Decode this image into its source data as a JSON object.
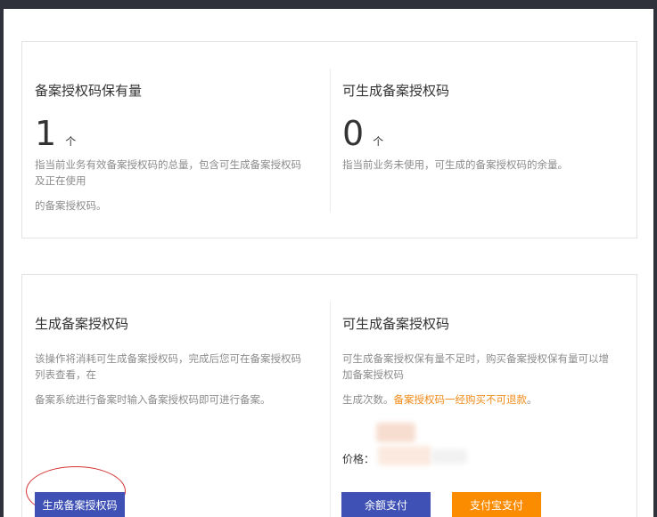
{
  "holdings_card": {
    "left": {
      "title": "备案授权码保有量",
      "count": "1",
      "unit": "个",
      "desc_line1": "指当前业务有效备案授权码的总量，包含可生成备案授权码及正在使用",
      "desc_line2": "的备案授权码。"
    },
    "right": {
      "title": "可生成备案授权码",
      "count": "0",
      "unit": "个",
      "desc": "指当前业务未使用，可生成的备案授权码的余量。"
    }
  },
  "generate_card": {
    "left": {
      "title": "生成备案授权码",
      "desc_line1": "该操作将消耗可生成备案授权码，完成后您可在备案授权码列表查看，在",
      "desc_line2": "备案系统进行备案时输入备案授权码即可进行备案。",
      "button_label": "生成备案授权码"
    },
    "right": {
      "title": "可生成备案授权码",
      "desc_line1": "可生成备案授权保有量不足时，购买备案授权保有量可以增加备案授权码",
      "desc_prefix": "生成次数。",
      "desc_warning": "备案授权码一经购买不可退款",
      "desc_suffix": "。",
      "price_label": "价格：",
      "balance_pay_label": "余额支付",
      "alipay_label": "支付宝支付"
    }
  },
  "colors": {
    "primary_button": "#3f51b5",
    "alipay_button": "#fb8c00",
    "warning_text": "#f08b1b",
    "annotation_ellipse": "#d43030"
  }
}
